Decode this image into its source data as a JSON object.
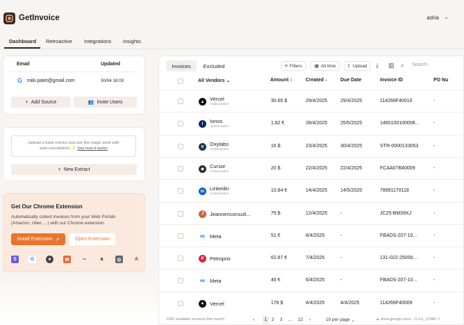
{
  "app": {
    "name": "GetInvoice",
    "user": "adria"
  },
  "nav_tabs": [
    {
      "label": "Dashboard",
      "active": true
    },
    {
      "label": "Retroactive"
    },
    {
      "label": "Integrations"
    },
    {
      "label": "Insights"
    }
  ],
  "accounts_card": {
    "email_header": "Email",
    "updated_header": "Updated",
    "email": "miki.palet@gmail.com",
    "updated": "30/04 18:00",
    "add_source": "Add Source",
    "invite_users": "Invite Users"
  },
  "upload_card": {
    "text_line1": "Upload a bank extract and see the magic work with",
    "text_line2": "auto-conciliation!",
    "link": "See how it works",
    "new_extract": "New Extract"
  },
  "chrome_card": {
    "title": "Get Our Chrome Extension",
    "description": "Automatically collect invoices from your Web Portals (Amazon, Uber, ...) with our Chrome extension.",
    "install": "Install Extension",
    "open": "Open Extension"
  },
  "invoice_tabs": [
    "Invoices",
    "Excluded"
  ],
  "toolbar": {
    "filters": "Filters",
    "all_time": "All time",
    "upload": "Upload",
    "search_placeholder": "Search"
  },
  "columns": {
    "vendors": "All Vendors",
    "amount": "Amount",
    "created": "Created",
    "due": "Due Date",
    "invoice_id": "Invoice ID",
    "po": "PO Nu"
  },
  "rows": [
    {
      "vendor": "Vercel",
      "sub": "Subscription",
      "amount": "30.65 $",
      "created": "29/4/2025",
      "due": "29/4/2025",
      "id": "114266F40010",
      "po": "-",
      "icon": "triangle-icon",
      "color": "#111111"
    },
    {
      "vendor": "Ionos",
      "sub": "Subscription",
      "amount": "1.82 €",
      "created": "28/4/2025",
      "due": "25/5/2025",
      "id": "1460100100008...",
      "po": "-",
      "icon": "ionos-icon",
      "color": "#0b2a6b"
    },
    {
      "vendor": "Oxylabs",
      "sub": "Subscription",
      "amount": "16 $",
      "created": "23/4/2025",
      "due": "30/4/2025",
      "id": "STR-0000133053",
      "po": "-",
      "icon": "oxylabs-icon",
      "color": "#1a3a4a"
    },
    {
      "vendor": "Cursor",
      "sub": "Subscription",
      "amount": "20 $",
      "created": "22/4/2025",
      "due": "22/4/2025",
      "id": "FCAA07B40009",
      "po": "-",
      "icon": "cursor-icon",
      "color": "#2b2b2b"
    },
    {
      "vendor": "Linkedin",
      "sub": "Subscription",
      "amount": "10.84 €",
      "created": "14/4/2025",
      "due": "14/5/2025",
      "id": "78991170118",
      "po": "-",
      "icon": "linkedin-icon",
      "color": "#0a66c2"
    },
    {
      "vendor": "Jeannenconsult...",
      "sub": "",
      "amount": "79 $",
      "created": "12/4/2025",
      "due": "-",
      "id": "JC25-BM39XJ",
      "po": "-",
      "icon": "person-icon",
      "color": "#c8663a"
    },
    {
      "vendor": "Meta",
      "sub": "",
      "amount": "51 €",
      "created": "8/4/2025",
      "due": "-",
      "id": "FBADS-207-10...",
      "po": "-",
      "icon": "meta-icon",
      "color": "#1877f2"
    },
    {
      "vendor": "Petroprix",
      "sub": "",
      "amount": "62.87 €",
      "created": "7/4/2025",
      "due": "-",
      "id": "131-022-25000...",
      "po": "-",
      "icon": "petroprix-icon",
      "color": "#d6263a"
    },
    {
      "vendor": "Meta",
      "sub": "",
      "amount": "46 €",
      "created": "6/4/2025",
      "due": "-",
      "id": "FBADS-207-10...",
      "po": "-",
      "icon": "meta-icon",
      "color": "#1877f2"
    },
    {
      "vendor": "Vercel",
      "sub": "",
      "amount": "178 $",
      "created": "4/4/2025",
      "due": "4/4/2025",
      "id": "114266F40009",
      "po": "-",
      "icon": "triangle-icon",
      "color": "#111111"
    }
  ],
  "footer": {
    "count": "1266 available invoices this month",
    "pages": [
      "1",
      "2",
      "3",
      "...",
      "22"
    ],
    "per_page": "10 per page",
    "drive": "drive.google.com/.../1-Cu_LO8M"
  }
}
